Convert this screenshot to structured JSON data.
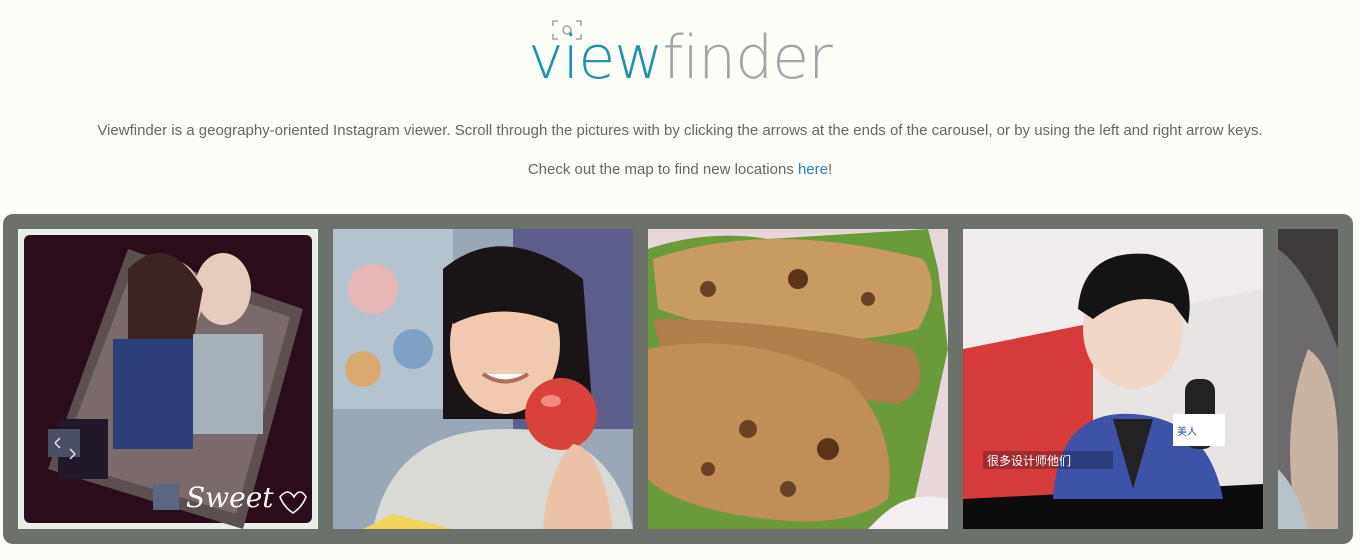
{
  "header": {
    "logo_part1": "view",
    "logo_part2": "finder"
  },
  "intro": {
    "description": "Viewfinder is a geography-oriented Instagram viewer. Scroll through the pictures with by clicking the arrows at the ends of the carousel, or by using the left and right arrow keys.",
    "cta_text": "Check out the map to find new locations ",
    "cta_link": "here",
    "cta_suffix": "!"
  },
  "carousel": {
    "photos": [
      {
        "overlay_text": "Sweet"
      },
      {},
      {},
      {
        "caption_text": "很多设计师他们"
      },
      {}
    ]
  },
  "colors": {
    "background": "#fcfdf7",
    "logo_view": "#1f93ad",
    "logo_finder": "#a3a6a8",
    "link": "#2e7bbf",
    "carousel_frame": "#6d716c"
  }
}
